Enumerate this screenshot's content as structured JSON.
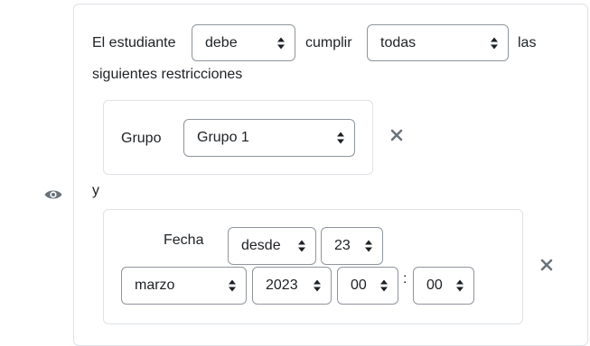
{
  "header": {
    "prefix": "El estudiante",
    "must_select": {
      "value": "debe"
    },
    "middle": "cumplir",
    "all_select": {
      "value": "todas"
    },
    "suffix": "las",
    "line2": "siguientes restricciones"
  },
  "group_condition": {
    "label": "Grupo",
    "select": {
      "value": "Grupo 1"
    }
  },
  "connector": "y",
  "date_condition": {
    "label": "Fecha",
    "direction_select": {
      "value": "desde"
    },
    "day_select": {
      "value": "23"
    },
    "month_select": {
      "value": "marzo"
    },
    "year_select": {
      "value": "2023"
    },
    "hour_select": {
      "value": "00"
    },
    "time_separator": ":",
    "minute_select": {
      "value": "00"
    }
  },
  "icons": {
    "visibility": "eye-icon",
    "remove": "close-icon",
    "caret": "sort-caret-icon"
  },
  "colors": {
    "text": "#1d2125",
    "border": "#8f959e",
    "card_border": "#dee2e6",
    "icon": "#6a737b"
  }
}
